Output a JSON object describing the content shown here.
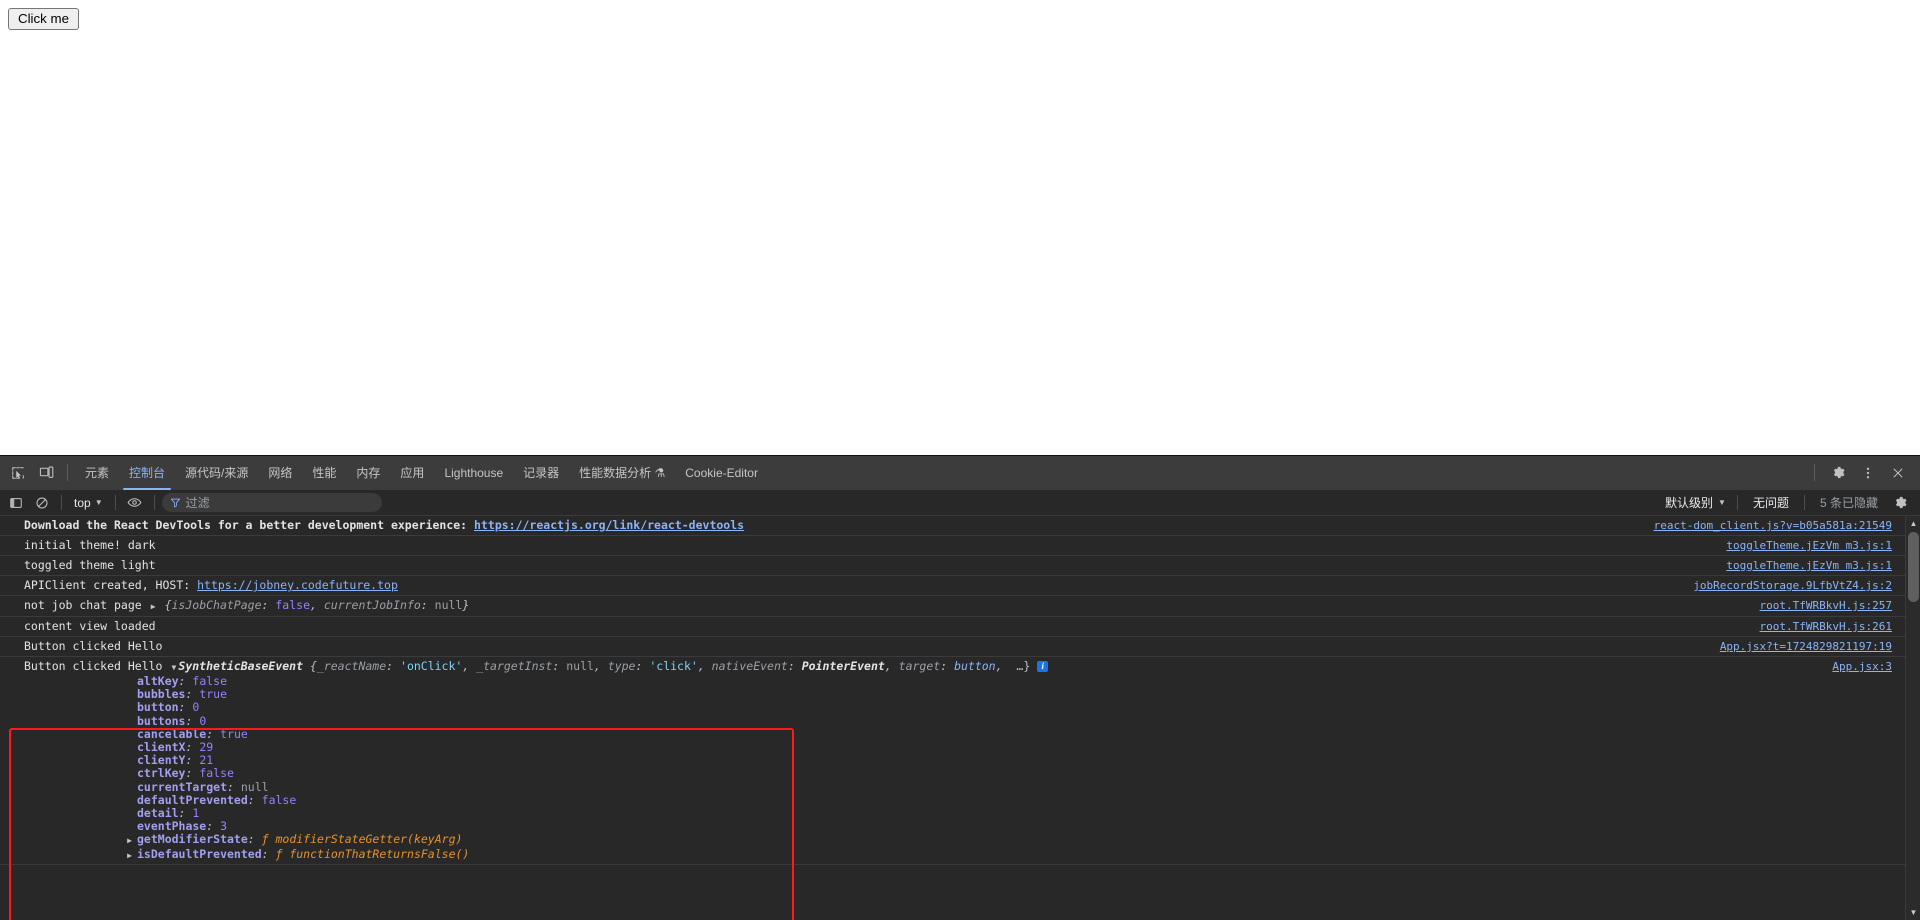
{
  "page": {
    "button_label": "Click me"
  },
  "devtools": {
    "tabs": [
      {
        "id": "elements",
        "label": "元素",
        "active": false
      },
      {
        "id": "console",
        "label": "控制台",
        "active": true
      },
      {
        "id": "sources",
        "label": "源代码/来源",
        "active": false
      },
      {
        "id": "network",
        "label": "网络",
        "active": false
      },
      {
        "id": "performance",
        "label": "性能",
        "active": false
      },
      {
        "id": "memory",
        "label": "内存",
        "active": false
      },
      {
        "id": "application",
        "label": "应用",
        "active": false
      },
      {
        "id": "lighthouse",
        "label": "Lighthouse",
        "active": false
      },
      {
        "id": "recorder",
        "label": "记录器",
        "active": false
      },
      {
        "id": "perf-insights",
        "label": "性能数据分析 ⚗",
        "active": false
      },
      {
        "id": "cookie-editor",
        "label": "Cookie-Editor",
        "active": false
      }
    ],
    "toolbar_right": {
      "settings_icon": "gear-icon",
      "more_icon": "kebab-menu-icon",
      "close_icon": "close-icon"
    },
    "filterbar": {
      "sidebar_toggle_icon": "console-sidebar-icon",
      "clear_icon": "clear-console-icon",
      "context_value": "top",
      "eye_icon": "live-expression-icon",
      "filter_icon": "filter-icon",
      "filter_placeholder": "过滤",
      "filter_value": "",
      "level_value": "默认级别",
      "issues_label": "无问题",
      "hidden_label": "5 条已隐藏",
      "settings_icon": "console-settings-gear-icon"
    },
    "messages": [
      {
        "id": "react-devtools",
        "bold": true,
        "text_before": "Download the React DevTools for a better development experience: ",
        "link": "https://reactjs.org/link/react-devtools",
        "source": "react-dom_client.js?v=b05a581a:21549"
      },
      {
        "id": "initial-theme",
        "bold": false,
        "text_before": "initial theme! dark",
        "link": "",
        "source": "toggleTheme.jEzVm m3.js:1"
      },
      {
        "id": "toggled-theme",
        "bold": false,
        "text_before": "toggled theme light",
        "link": "",
        "source": "toggleTheme.jEzVm m3.js:1"
      },
      {
        "id": "apiclient",
        "bold": false,
        "text_before": "APIClient created, HOST: ",
        "link": "https://jobney.codefuture.top",
        "source": "jobRecordStorage.9LfbVtZ4.js:2"
      },
      {
        "id": "not-job-chat-page",
        "bold": false,
        "text_before": "not job chat page ",
        "object_preview": {
          "collapsed_triangle": "▶",
          "open_brace": "{",
          "entries": [
            {
              "key": "isJobChatPage",
              "value": "false",
              "value_type": "bool"
            },
            {
              "key": "currentJobInfo",
              "value": "null",
              "value_type": "null"
            }
          ],
          "close_brace": "}"
        },
        "source": "root.TfWRBkvH.js:257"
      },
      {
        "id": "content-view-loaded",
        "bold": false,
        "text_before": "content view loaded",
        "link": "",
        "source": "root.TfWRBkvH.js:261"
      },
      {
        "id": "button-clicked-1",
        "bold": false,
        "text_before": "Button clicked Hello",
        "link": "",
        "source": "App.jsx?t=1724829821197:19"
      }
    ],
    "expanded_event": {
      "prefix_text": "Button clicked Hello ",
      "triangle": "▼",
      "ctor_name": "SyntheticBaseEvent",
      "preview_open": "{",
      "preview_entries": [
        {
          "key": "_reactName",
          "value": "'onClick'",
          "value_type": "string"
        },
        {
          "key": "_targetInst",
          "value": "null",
          "value_type": "null"
        },
        {
          "key": "type",
          "value": "'click'",
          "value_type": "string"
        },
        {
          "key": "nativeEvent",
          "value": "PointerEvent",
          "value_type": "ctor"
        },
        {
          "key": "target",
          "value": "button",
          "value_type": "element"
        }
      ],
      "preview_ellipsis": "…}",
      "info_badge": "i",
      "source": "App.jsx:3",
      "properties": [
        {
          "name": "altKey",
          "value": "false",
          "type": "bool",
          "expandable": false
        },
        {
          "name": "bubbles",
          "value": "true",
          "type": "bool",
          "expandable": false
        },
        {
          "name": "button",
          "value": "0",
          "type": "num",
          "expandable": false
        },
        {
          "name": "buttons",
          "value": "0",
          "type": "num",
          "expandable": false
        },
        {
          "name": "cancelable",
          "value": "true",
          "type": "bool",
          "expandable": false
        },
        {
          "name": "clientX",
          "value": "29",
          "type": "num",
          "expandable": false
        },
        {
          "name": "clientY",
          "value": "21",
          "type": "num",
          "expandable": false
        },
        {
          "name": "ctrlKey",
          "value": "false",
          "type": "bool",
          "expandable": false
        },
        {
          "name": "currentTarget",
          "value": "null",
          "type": "null",
          "expandable": false
        },
        {
          "name": "defaultPrevented",
          "value": "false",
          "type": "bool",
          "expandable": false
        },
        {
          "name": "detail",
          "value": "1",
          "type": "num",
          "expandable": false
        },
        {
          "name": "eventPhase",
          "value": "3",
          "type": "num",
          "expandable": false
        },
        {
          "name": "getModifierState",
          "value": "ƒ modifierStateGetter(keyArg)",
          "type": "fn",
          "expandable": true
        },
        {
          "name": "isDefaultPrevented",
          "value": "ƒ functionThatReturnsFalse()",
          "type": "fn",
          "expandable": true
        }
      ]
    },
    "scrollbar": {
      "up_arrow": "▲",
      "down_arrow": "▼"
    }
  }
}
